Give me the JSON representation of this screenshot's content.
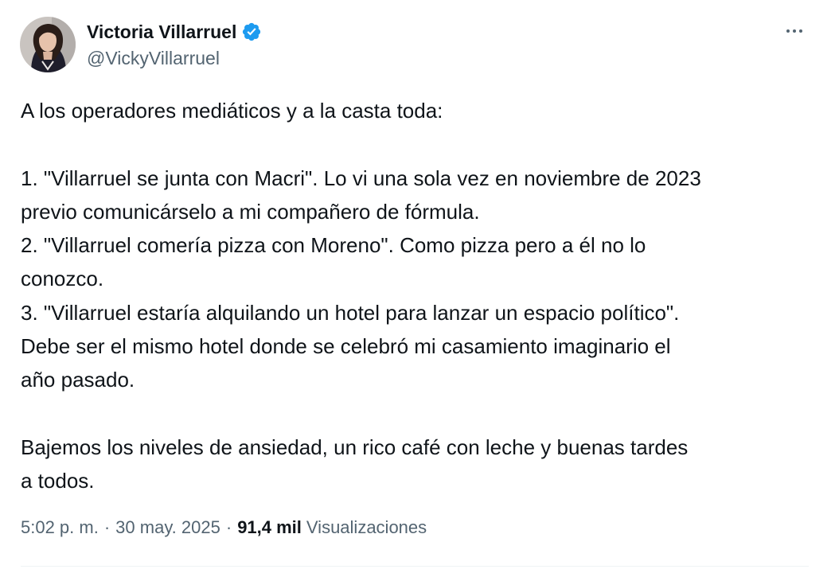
{
  "author": {
    "display_name": "Victoria Villarruel",
    "handle": "@VickyVillarruel",
    "verified": true,
    "verified_color": "#1d9bf0",
    "avatar_icon": "profile-photo"
  },
  "tweet": {
    "lines": [
      "A los operadores mediáticos y a la casta toda:",
      "",
      "1. \"Villarruel se junta con Macri\". Lo vi una sola vez en noviembre de 2023",
      "previo comunicárselo a mi compañero de fórmula.",
      "2. \"Villarruel comería pizza con Moreno\". Como pizza pero a él no lo",
      "conozco.",
      "3. \"Villarruel estaría alquilando un hotel para lanzar un espacio político\".",
      "Debe ser el mismo hotel donde se celebró mi casamiento imaginario el",
      "año pasado.",
      "",
      "Bajemos los niveles de ansiedad, un rico café con leche y buenas tardes",
      "a todos."
    ]
  },
  "meta": {
    "time": "5:02 p. m.",
    "separator": "·",
    "date": "30 may. 2025",
    "views_count": "91,4 mil",
    "views_label": "Visualizaciones"
  },
  "colors": {
    "text": "#0f1419",
    "secondary": "#536471",
    "divider": "#eff3f4"
  }
}
